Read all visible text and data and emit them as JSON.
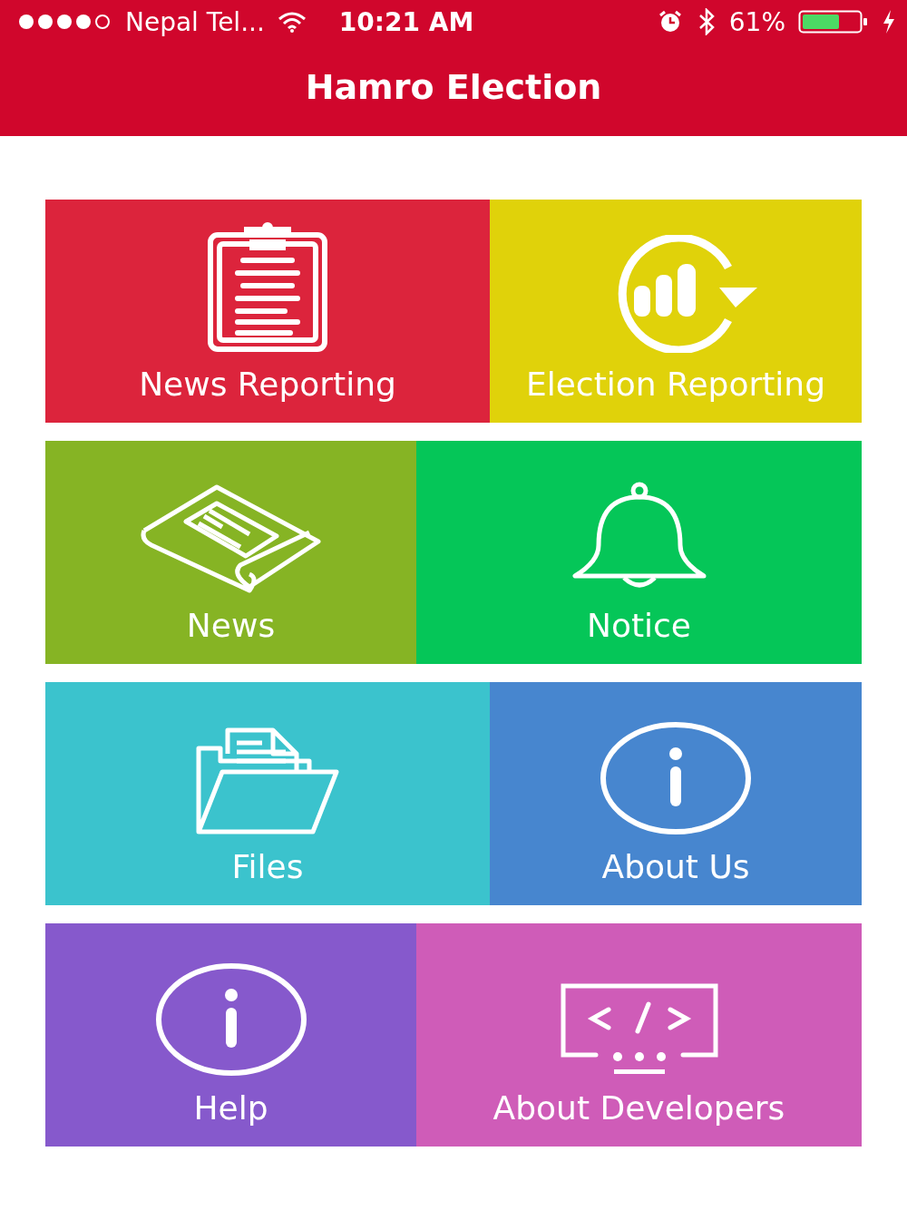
{
  "status_bar": {
    "carrier": "Nepal Tel...",
    "time": "10:21 AM",
    "battery": "61%"
  },
  "header": {
    "title": "Hamro Election"
  },
  "rows": [
    {
      "tiles": [
        {
          "label": "News Reporting",
          "kind": "clipboard",
          "color": "#dc243c"
        },
        {
          "label": "Election Reporting",
          "kind": "chart",
          "color": "#e0d20a"
        }
      ]
    },
    {
      "tiles": [
        {
          "label": "News",
          "kind": "newspaper",
          "color": "#86b424"
        },
        {
          "label": "Notice",
          "kind": "bell",
          "color": "#05c658"
        }
      ]
    },
    {
      "tiles": [
        {
          "label": "Files",
          "kind": "folder",
          "color": "#3bc3cd"
        },
        {
          "label": "About Us",
          "kind": "info",
          "color": "#4786cf"
        }
      ]
    },
    {
      "tiles": [
        {
          "label": "Help",
          "kind": "info",
          "color": "#8659cc"
        },
        {
          "label": "About Developers",
          "kind": "code",
          "color": "#cf5cb8"
        }
      ]
    }
  ]
}
